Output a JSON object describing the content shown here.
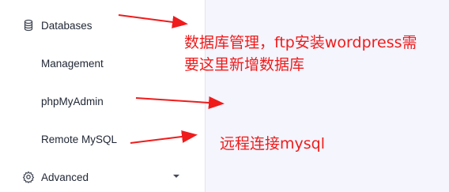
{
  "sidebar": {
    "databases_label": "Databases",
    "databases_icon": "database-icon",
    "management_label": "Management",
    "phpmyadmin_label": "phpMyAdmin",
    "remote_mysql_label": "Remote MySQL",
    "advanced_label": "Advanced",
    "advanced_icon": "gear-icon"
  },
  "annotations": {
    "note_line1": "数据库管理，ftp安装wordpress需",
    "note_line2": "要这里新增数据库",
    "note_remote": "远程连接mysql",
    "color": "#ef1c1c"
  }
}
